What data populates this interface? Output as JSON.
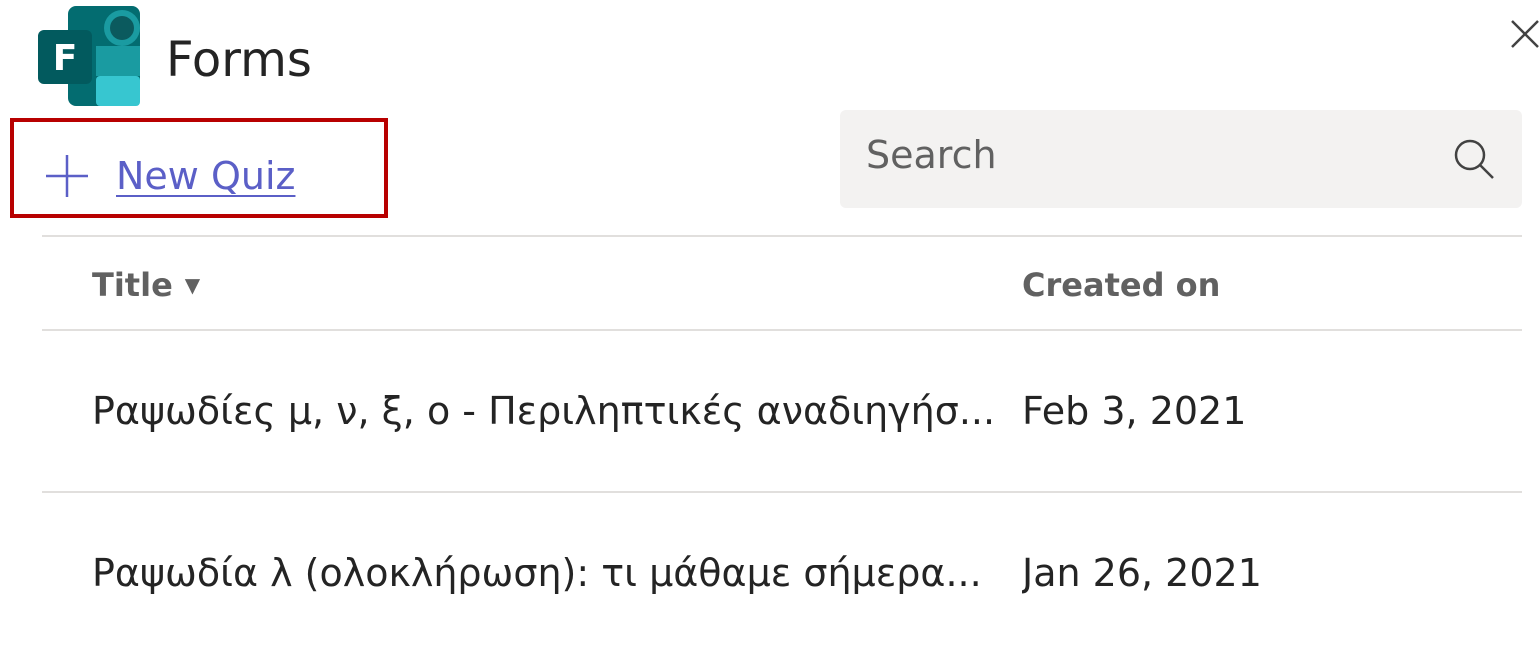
{
  "app": {
    "title": "Forms",
    "logo_letter": "F",
    "logo_colors": {
      "main": "#036c70",
      "dark": "#1a9ba1",
      "light": "#37c6d0",
      "letter_box": "#025a5e"
    }
  },
  "toolbar": {
    "new_quiz_label": "New Quiz",
    "highlight_color": "#b80000",
    "accent_color": "#5b5fc7"
  },
  "search": {
    "placeholder": "Search",
    "icon": "search-icon"
  },
  "table": {
    "columns": [
      {
        "label": "Title",
        "sort_icon": "▼"
      },
      {
        "label": "Created on"
      }
    ],
    "rows": [
      {
        "title": "Ραψωδίες μ, ν, ξ, ο - Περιληπτικές αναδιηγήσ...",
        "created_on": "Feb 3, 2021"
      },
      {
        "title": "Ραψωδία λ (ολοκλήρωση): τι μάθαμε σήμερα...",
        "created_on": "Jan 26, 2021"
      }
    ]
  }
}
